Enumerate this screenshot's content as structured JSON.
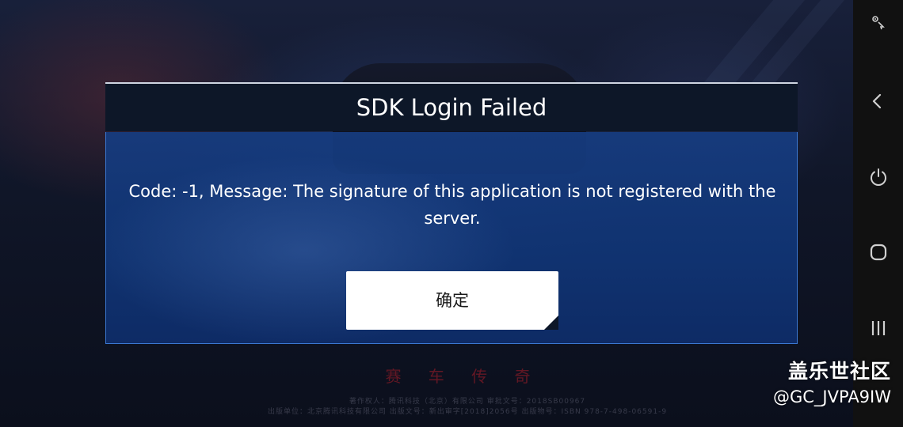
{
  "dialog": {
    "title": "SDK Login Failed",
    "message": "Code: -1, Message: The signature of this application is not registered with the server.",
    "confirm_label": "确定"
  },
  "background": {
    "footer_line_1": "著作权人：腾讯科技（北京）有限公司  审批文号：2018SB00967",
    "footer_line_2": "出版单位：北京腾讯科技有限公司  出版文号：新出审字[2018]2056号  出版物号：ISBN 978-7-498-06591-9"
  },
  "nav_bar": {
    "items": [
      {
        "icon": "pointer-gesture-icon"
      },
      {
        "icon": "back-chevron-icon"
      },
      {
        "icon": "power-icon"
      },
      {
        "icon": "home-icon"
      },
      {
        "icon": "recent-apps-icon"
      }
    ]
  },
  "watermark": {
    "title": "盖乐世社区",
    "user": "@GC_JVPA9IW"
  },
  "colors": {
    "dialog_header": "#0d1728",
    "dialog_body": "#163c80",
    "dialog_border": "#3b78d2",
    "button_bg": "#ffffff"
  }
}
